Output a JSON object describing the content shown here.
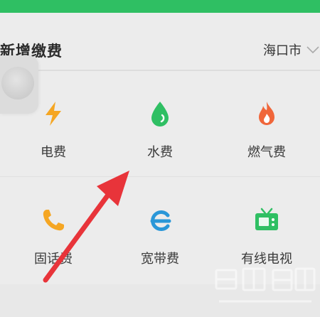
{
  "header": {
    "title": "新增缴费",
    "city": "海口市"
  },
  "grid": {
    "items": [
      {
        "label": "电费",
        "icon": "electricity-bolt-icon",
        "color": "#f5a623"
      },
      {
        "label": "水费",
        "icon": "water-drop-icon",
        "color": "#2fbf63"
      },
      {
        "label": "燃气费",
        "icon": "gas-flame-icon",
        "color": "#f0663a"
      },
      {
        "label": "固话费",
        "icon": "phone-icon",
        "color": "#f5a623"
      },
      {
        "label": "宽带费",
        "icon": "broadband-e-icon",
        "color": "#2a97d8"
      },
      {
        "label": "有线电视",
        "icon": "tv-icon",
        "color": "#2fbf63"
      }
    ]
  },
  "colors": {
    "accent_green": "#2fbf63",
    "annotation_arrow": "#e8343a"
  }
}
